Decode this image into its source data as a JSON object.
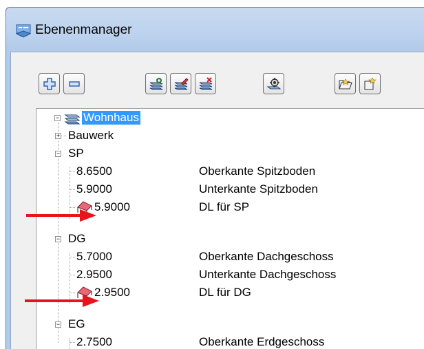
{
  "window": {
    "title": "Ebenenmanager"
  },
  "toolbar": {
    "buttons": [
      {
        "icon": "plus-icon"
      },
      {
        "icon": "minus-icon"
      },
      {
        "icon": "add-layer-icon"
      },
      {
        "icon": "edit-layer-icon"
      },
      {
        "icon": "delete-layer-icon"
      },
      {
        "icon": "settings-icon"
      },
      {
        "icon": "open-folder-icon"
      },
      {
        "icon": "export-icon"
      }
    ]
  },
  "tree": {
    "root": {
      "label": "Wohnhaus",
      "expanded": true,
      "selected": true
    },
    "groups": [
      {
        "label": "Bauwerk",
        "expanded": false,
        "children": []
      },
      {
        "label": "SP",
        "expanded": true,
        "children": [
          {
            "value": "8.6500",
            "desc": "Oberkante Spitzboden",
            "roof": false
          },
          {
            "value": "5.9000",
            "desc": "Unterkante Spitzboden",
            "roof": false
          },
          {
            "value": "5.9000",
            "desc": "DL für SP",
            "roof": true
          }
        ]
      },
      {
        "label": "DG",
        "expanded": true,
        "children": [
          {
            "value": "5.7000",
            "desc": "Oberkante Dachgeschoss",
            "roof": false
          },
          {
            "value": "2.9500",
            "desc": "Unterkante Dachgeschoss",
            "roof": false
          },
          {
            "value": "2.9500",
            "desc": "DL für DG",
            "roof": true
          }
        ]
      },
      {
        "label": "EG",
        "expanded": true,
        "children": [
          {
            "value": "2.7500",
            "desc": "Oberkante Erdgeschoss",
            "roof": false
          }
        ]
      }
    ]
  },
  "colors": {
    "selection": "#3399ff",
    "arrow": "#e8141b",
    "roof": "#d94a5a"
  }
}
